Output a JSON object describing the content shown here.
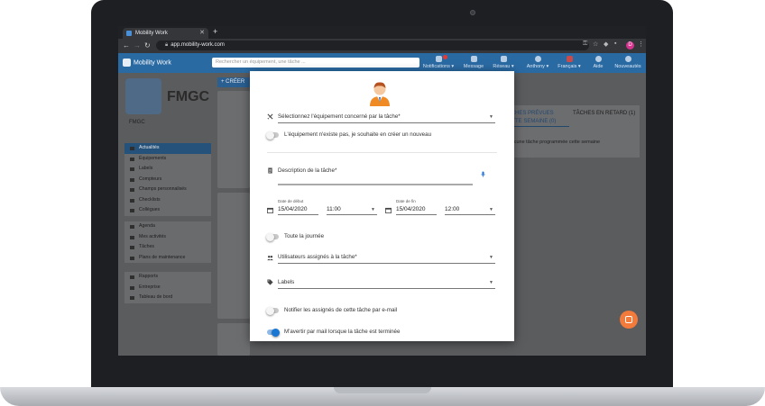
{
  "browser": {
    "tab_title": "Mobility Work",
    "url": "app.mobility-work.com",
    "profile_initial": "D"
  },
  "app": {
    "brand": "Mobility Work",
    "search_placeholder": "Rechercher un équipement, une tâche ...",
    "nav": {
      "notifications": "Notifications",
      "messages": "Message",
      "reseau": "Réseau",
      "user": "Anthony",
      "language": "Français",
      "help": "Aide",
      "news": "Nouveautés"
    }
  },
  "sidebar": {
    "logo_text": "FMGC",
    "org_name": "FMGC",
    "group1": [
      {
        "label": "Actualités",
        "active": true
      },
      {
        "label": "Équipements"
      },
      {
        "label": "Labels"
      },
      {
        "label": "Compteurs"
      },
      {
        "label": "Champs personnalisés"
      },
      {
        "label": "Checklists"
      },
      {
        "label": "Collègues"
      }
    ],
    "group2": [
      {
        "label": "Agenda"
      },
      {
        "label": "Mes activités"
      },
      {
        "label": "Tâches"
      },
      {
        "label": "Plans de maintenance"
      }
    ],
    "group3": [
      {
        "label": "Rapports"
      },
      {
        "label": "Entreprise"
      },
      {
        "label": "Tableau de bord"
      }
    ]
  },
  "feed": {
    "create_label": "+ CRÉER"
  },
  "right_panel": {
    "tab_planned": "TÂCHES PRÉVUES CETTE SEMAINE (0)",
    "tab_late": "TÂCHES EN RETARD (1)",
    "empty_note": "Aucune tâche programmée cette semaine"
  },
  "modal": {
    "equipment_field": "Sélectionnez l'équipement concerné par la tâche*",
    "equipment_missing_toggle": "L'équipement n'existe pas, je souhaite en créer un nouveau",
    "description_field": "Description de la tâche*",
    "start_date_label": "Date de début",
    "start_date": "15/04/2020",
    "start_time": "11:00",
    "end_date_label": "Date de fin",
    "end_date": "15/04/2020",
    "end_time": "12:00",
    "all_day_toggle": "Toute la journée",
    "assigned_users_field": "Utilisateurs assignés à la tâche*",
    "labels_field": "Labels",
    "notify_assignees_toggle": "Notifier les assignés de cette tâche par e-mail",
    "notify_me_toggle": "M'avertir par mail lorsque la tâche est terminée",
    "notify_me_on": true
  },
  "colors": {
    "header_blue": "#2a6aa3",
    "accent_blue": "#1976d2",
    "chat_orange": "#f27a3b"
  }
}
